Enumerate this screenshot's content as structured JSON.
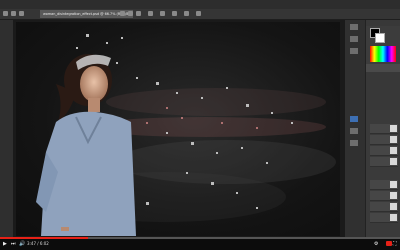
{
  "app": {
    "name": "Photoshop",
    "document_tab": "woman_disintegration_effect.psd @ 66.7% (RGB/8)"
  },
  "menu": {
    "items": [
      "Ps",
      "File",
      "Edit",
      "Image",
      "Layer",
      "Type",
      "Select",
      "Filter",
      "3D",
      "View",
      "Window",
      "Help"
    ]
  },
  "player": {
    "timecode": "3:47 / 6:02",
    "progress_fraction": 0.22,
    "icons": [
      "play-icon",
      "next-icon",
      "volume-icon",
      "settings-icon",
      "fullscreen-icon"
    ],
    "accent": "#e62117"
  },
  "panels": {
    "icons": [
      "history-icon",
      "brush-settings-icon",
      "adjustments-icon",
      "layers-icon",
      "channels-icon",
      "paths-icon"
    ]
  }
}
